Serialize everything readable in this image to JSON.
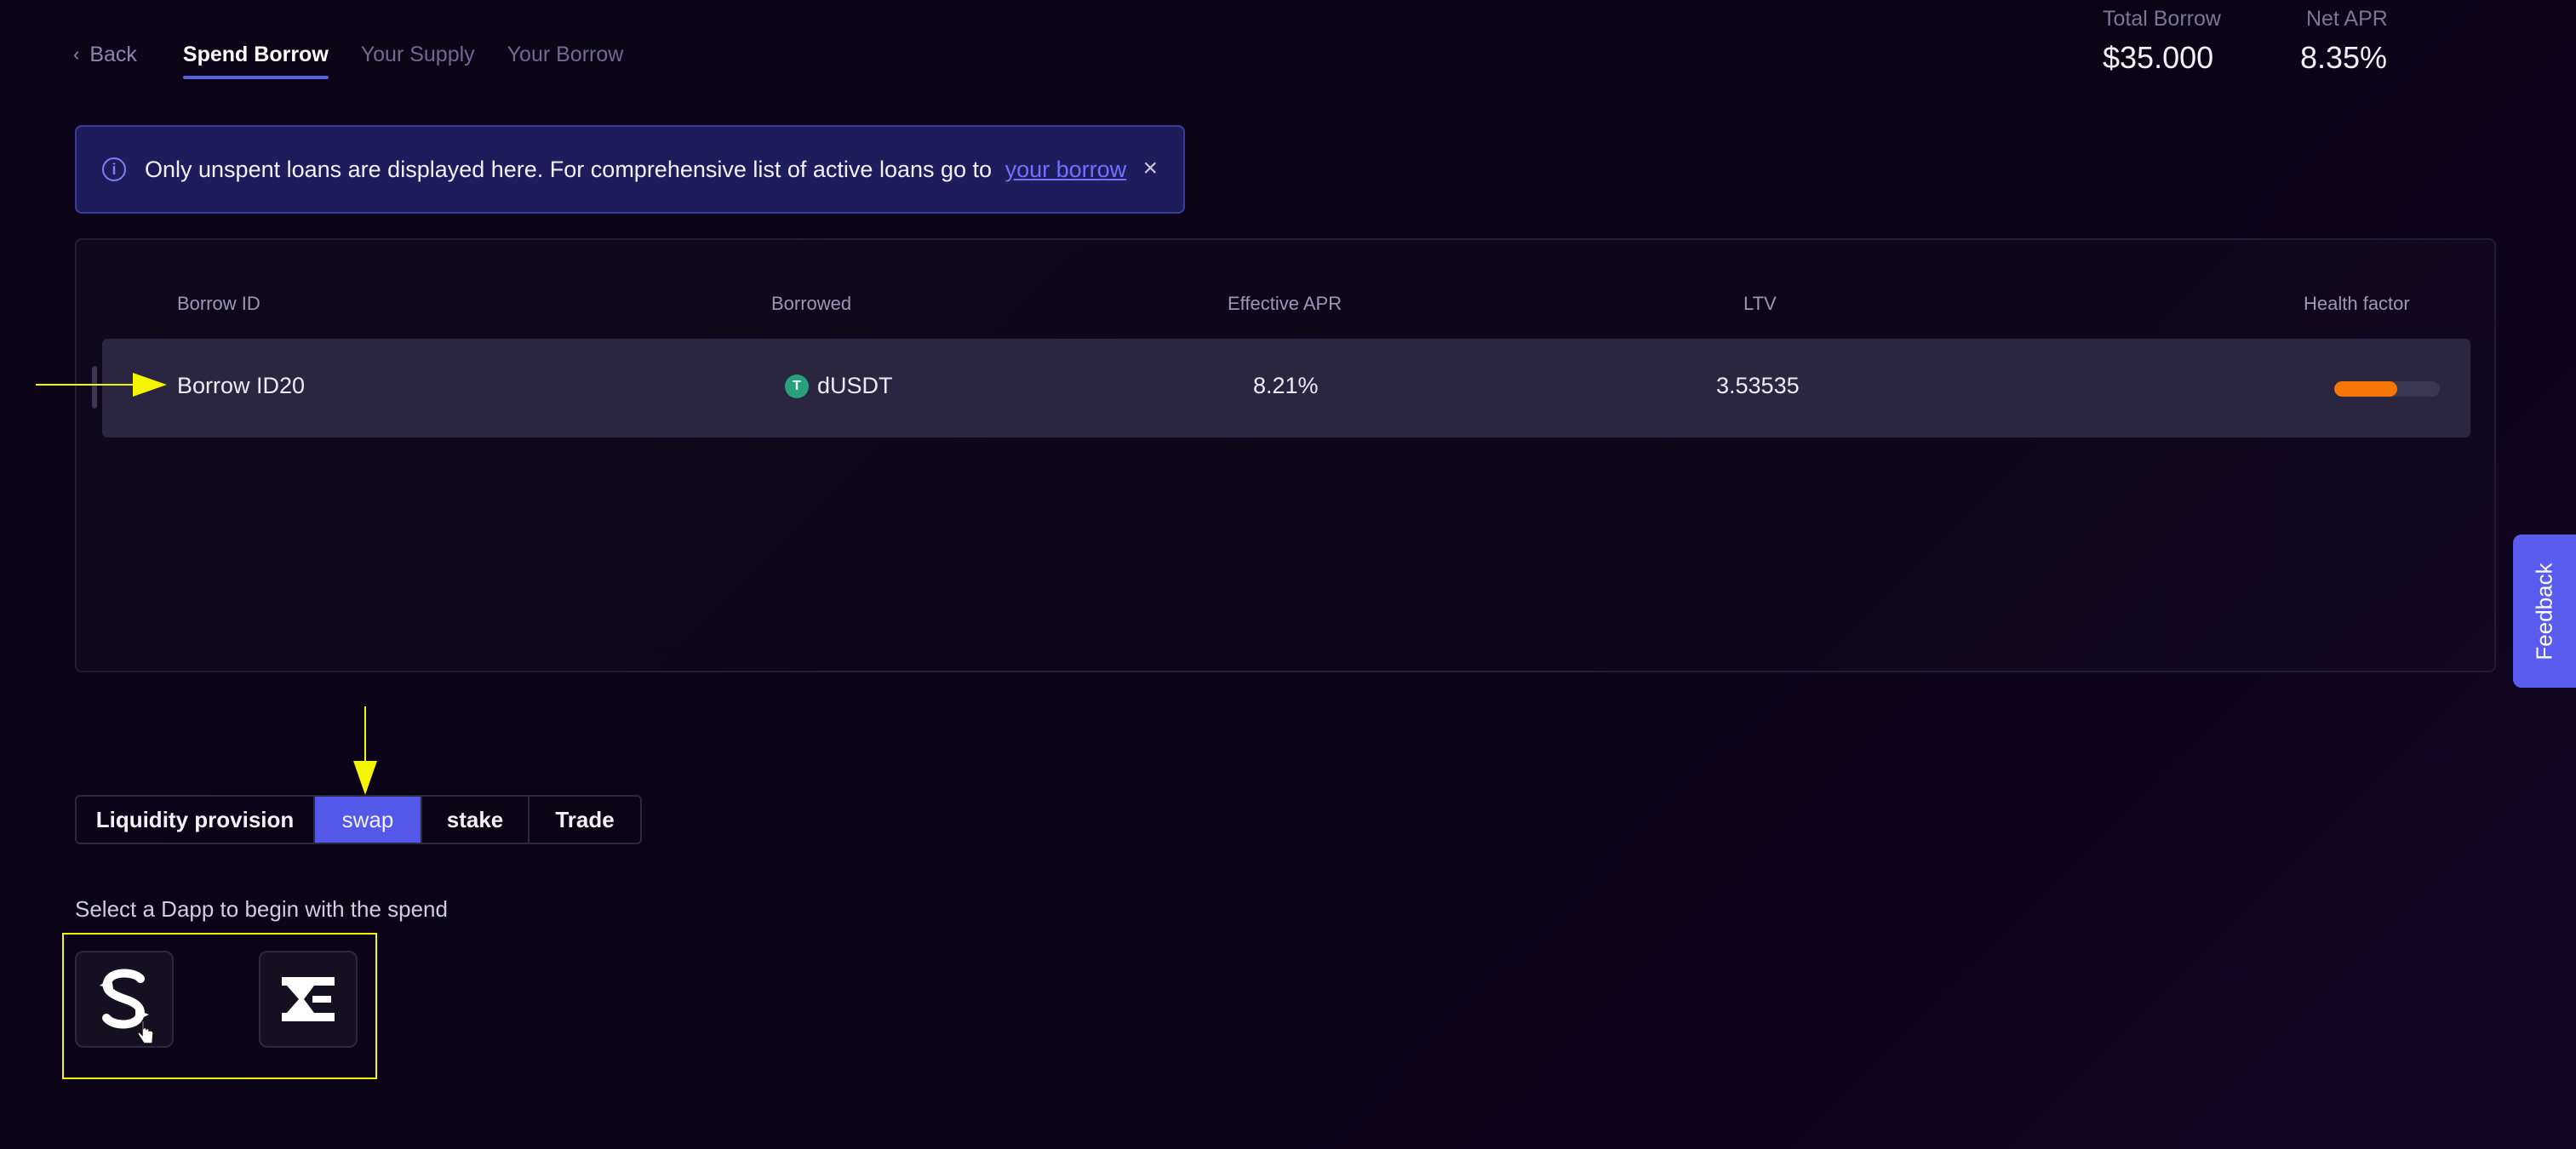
{
  "nav": {
    "back_label": "Back",
    "tabs": [
      {
        "label": "Spend Borrow",
        "active": true
      },
      {
        "label": "Your Supply",
        "active": false
      },
      {
        "label": "Your Borrow",
        "active": false
      }
    ]
  },
  "stats": {
    "total_borrow_label": "Total Borrow",
    "total_borrow_value": "$35.000",
    "net_apr_label": "Net APR",
    "net_apr_value": "8.35%"
  },
  "banner": {
    "text": "Only unspent loans are displayed here. For comprehensive list of active loans go to",
    "link_text": "your borrow",
    "close_glyph": "×"
  },
  "table": {
    "headers": [
      "Borrow ID",
      "Borrowed",
      "Effective APR",
      "LTV",
      "Health factor"
    ],
    "rows": [
      {
        "borrow_id": "Borrow ID20",
        "borrowed_token": "dUSDT",
        "token_glyph": "T",
        "effective_apr": "8.21%",
        "ltv": "3.53535",
        "health_factor_fraction": 0.6
      }
    ]
  },
  "feedback_label": "Feedback",
  "categories": [
    {
      "label": "Liquidity provision",
      "active": false
    },
    {
      "label": "swap",
      "active": true
    },
    {
      "label": "stake",
      "active": false
    },
    {
      "label": "Trade",
      "active": false
    }
  ],
  "select_label": "Select a Dapp to begin with the spend",
  "dapps": [
    {
      "icon": "sushi-s-logo-icon"
    },
    {
      "icon": "zeta-logo-icon"
    }
  ],
  "colors": {
    "accent": "#5358e8",
    "health_bar": "#f57507",
    "annotation": "#f5f500",
    "link": "#6f72ff"
  }
}
